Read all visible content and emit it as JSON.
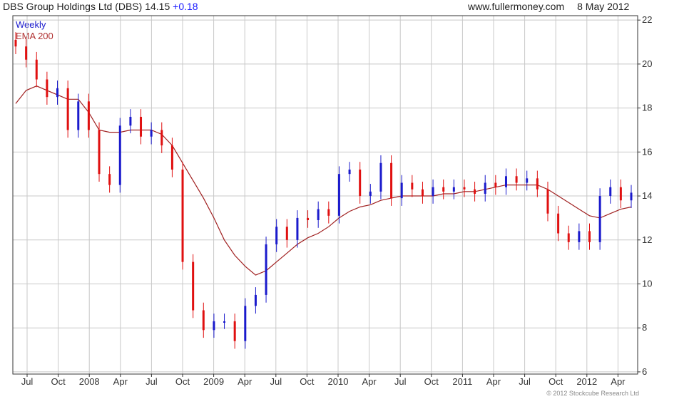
{
  "header": {
    "name": "DBS Group Holdings Ltd (DBS)",
    "price": "14.15",
    "change": "+0.18",
    "site": "www.fullermoney.com",
    "date": "8 May 2012"
  },
  "legend": {
    "series1": "Weekly",
    "series2": "EMA 200"
  },
  "copyright": "© 2012 Stockcube Research Ltd",
  "colors": {
    "up": "#1a1acc",
    "down": "#e01010",
    "ema": "#a02020",
    "grid": "#c8c8c8",
    "frame": "#333333"
  },
  "chart_data": {
    "type": "line",
    "title": "DBS Group Holdings Ltd (DBS) 14.15 +0.18",
    "xlabel": "",
    "ylabel": "",
    "ylim": [
      5.9,
      22.2
    ],
    "yticks": [
      6,
      8,
      10,
      12,
      14,
      16,
      18,
      20,
      22
    ],
    "x_tick_labels": [
      "Jul",
      "Oct",
      "2008",
      "Apr",
      "Jul",
      "Oct",
      "2009",
      "Apr",
      "Jul",
      "Oct",
      "2010",
      "Apr",
      "Jul",
      "Oct",
      "2011",
      "Apr",
      "Jul",
      "Oct",
      "2012",
      "Apr"
    ],
    "grid": true,
    "series": [
      {
        "name": "Weekly",
        "style": "candlestick",
        "x": [
          "2007-06",
          "2007-07",
          "2007-08",
          "2007-09",
          "2007-10",
          "2007-11",
          "2007-12",
          "2008-01",
          "2008-02",
          "2008-03",
          "2008-04",
          "2008-05",
          "2008-06",
          "2008-07",
          "2008-08",
          "2008-09",
          "2008-10",
          "2008-11",
          "2008-12",
          "2009-01",
          "2009-02",
          "2009-03",
          "2009-04",
          "2009-05",
          "2009-06",
          "2009-07",
          "2009-08",
          "2009-09",
          "2009-10",
          "2009-11",
          "2009-12",
          "2010-01",
          "2010-02",
          "2010-03",
          "2010-04",
          "2010-05",
          "2010-06",
          "2010-07",
          "2010-08",
          "2010-09",
          "2010-10",
          "2010-11",
          "2010-12",
          "2011-01",
          "2011-02",
          "2011-03",
          "2011-04",
          "2011-05",
          "2011-06",
          "2011-07",
          "2011-08",
          "2011-09",
          "2011-10",
          "2011-11",
          "2011-12",
          "2012-01",
          "2012-02",
          "2012-03",
          "2012-04",
          "2012-05"
        ],
        "values": [
          20.8,
          20.2,
          19.3,
          18.5,
          18.9,
          17.0,
          18.3,
          17.0,
          15.0,
          14.5,
          17.2,
          17.6,
          16.7,
          17.0,
          16.3,
          15.2,
          11.0,
          8.8,
          7.9,
          8.3,
          8.3,
          7.4,
          9.0,
          9.5,
          11.8,
          12.6,
          12.0,
          13.0,
          12.9,
          13.4,
          13.1,
          15.0,
          15.2,
          14.0,
          14.2,
          15.5,
          13.9,
          14.6,
          14.3,
          14.0,
          14.4,
          14.2,
          14.4,
          14.3,
          14.1,
          14.6,
          14.4,
          14.9,
          14.6,
          14.8,
          14.3,
          13.2,
          12.3,
          11.9,
          12.4,
          11.9,
          14.0,
          14.4,
          13.8,
          14.15
        ]
      },
      {
        "name": "EMA 200",
        "style": "line",
        "x": [
          "2007-06",
          "2007-07",
          "2007-08",
          "2007-09",
          "2007-10",
          "2007-11",
          "2007-12",
          "2008-01",
          "2008-02",
          "2008-03",
          "2008-04",
          "2008-05",
          "2008-06",
          "2008-07",
          "2008-08",
          "2008-09",
          "2008-10",
          "2008-11",
          "2008-12",
          "2009-01",
          "2009-02",
          "2009-03",
          "2009-04",
          "2009-05",
          "2009-06",
          "2009-07",
          "2009-08",
          "2009-09",
          "2009-10",
          "2009-11",
          "2009-12",
          "2010-01",
          "2010-02",
          "2010-03",
          "2010-04",
          "2010-05",
          "2010-06",
          "2010-07",
          "2010-08",
          "2010-09",
          "2010-10",
          "2010-11",
          "2010-12",
          "2011-01",
          "2011-02",
          "2011-03",
          "2011-04",
          "2011-05",
          "2011-06",
          "2011-07",
          "2011-08",
          "2011-09",
          "2011-10",
          "2011-11",
          "2011-12",
          "2012-01",
          "2012-02",
          "2012-03",
          "2012-04",
          "2012-05"
        ],
        "values": [
          18.2,
          18.8,
          19.0,
          18.8,
          18.6,
          18.4,
          18.4,
          17.8,
          17.0,
          16.9,
          16.9,
          17.0,
          17.0,
          17.0,
          16.8,
          16.3,
          15.5,
          14.7,
          13.9,
          13.0,
          12.0,
          11.3,
          10.8,
          10.4,
          10.6,
          11.0,
          11.4,
          11.8,
          12.1,
          12.3,
          12.6,
          13.0,
          13.3,
          13.5,
          13.6,
          13.8,
          13.9,
          14.0,
          14.0,
          14.0,
          14.0,
          14.1,
          14.1,
          14.2,
          14.2,
          14.3,
          14.4,
          14.5,
          14.5,
          14.5,
          14.5,
          14.3,
          14.0,
          13.7,
          13.4,
          13.1,
          13.0,
          13.2,
          13.4,
          13.5
        ]
      }
    ]
  }
}
